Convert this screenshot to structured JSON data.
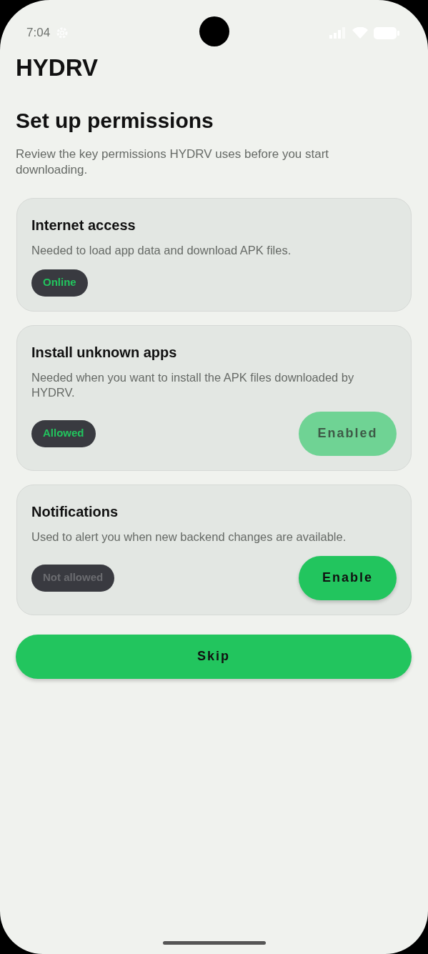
{
  "status_bar": {
    "time": "7:04"
  },
  "app_title": "HYDRV",
  "heading": "Set up permissions",
  "intro": "Review the key permissions HYDRV uses before you start downloading.",
  "permissions": [
    {
      "title": "Internet access",
      "description": "Needed to load app data and download APK files.",
      "status": {
        "label": "Online",
        "granted": true
      }
    },
    {
      "title": "Install unknown apps",
      "description": "Needed when you want to install the APK files downloaded by HYDRV.",
      "status": {
        "label": "Allowed",
        "granted": true
      },
      "button": {
        "label": "Enabled",
        "disabled": true
      }
    },
    {
      "title": "Notifications",
      "description": "Used to alert you when new backend changes are available.",
      "status": {
        "label": "Not allowed",
        "granted": false
      },
      "button": {
        "label": "Enable",
        "disabled": false
      }
    }
  ],
  "skip_button": {
    "label": "Skip"
  }
}
